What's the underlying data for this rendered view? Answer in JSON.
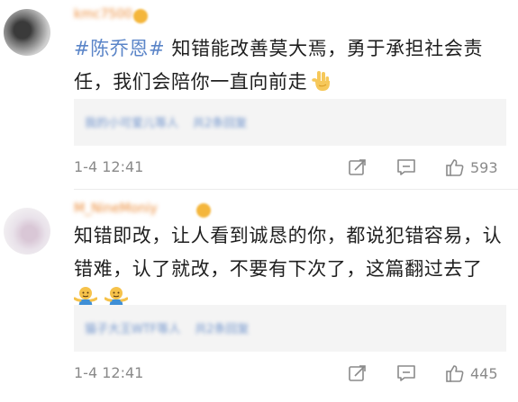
{
  "comments": [
    {
      "username": "kmc7500",
      "hashtag": "#陈乔恩#",
      "text": " 知错能改善莫大焉，勇于承担社会责任，我们会陪你一直向前走",
      "reply_preview": "我的小可爱儿等人",
      "reply_more": "共2条回复",
      "time": "1-4 12:41",
      "likes": "593"
    },
    {
      "username": "M_NineMoniy",
      "text": "知错即改，让人看到诚恳的你，都说犯错容易，认错难，认了就改，不要有下次了，这篇翻过去了",
      "reply_preview": "猫子大王WTF等人",
      "reply_more": "共2条回复",
      "time": "1-4 12:41",
      "likes": "445"
    }
  ],
  "icons": {
    "repost": "repost-icon",
    "comment": "comment-icon",
    "like": "thumbs-up-icon",
    "victory": "victory-hand-emoji",
    "shrug": "shrug-emoji"
  },
  "colors": {
    "hashtag": "#5b85c8",
    "username": "#eb8a36",
    "meta": "#8a8a8a"
  }
}
